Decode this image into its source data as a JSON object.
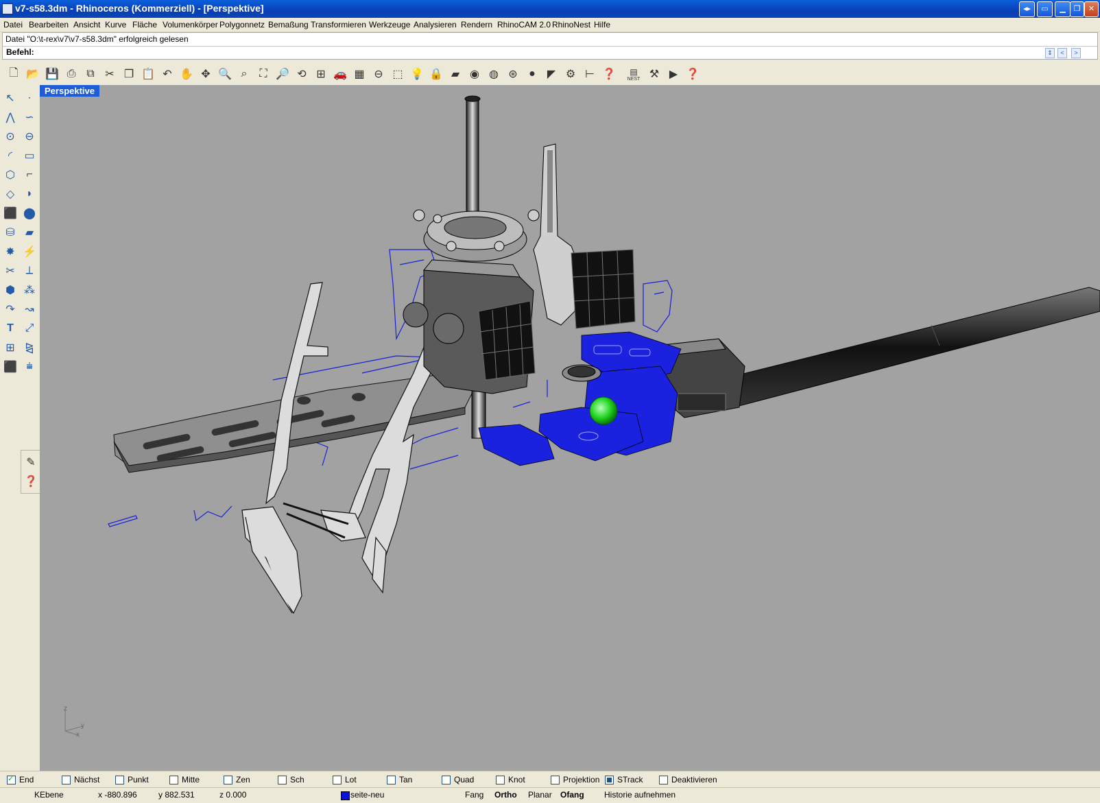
{
  "window": {
    "title": "v7-s58.3dm - Rhinoceros (Kommerziell) - [Perspektive]"
  },
  "menu": [
    "Datei",
    "Bearbeiten",
    "Ansicht",
    "Kurve",
    "Fläche",
    "Volumenkörper",
    "Polygonnetz",
    "Bemaßung",
    "Transformieren",
    "Werkzeuge",
    "Analysieren",
    "Rendern",
    "RhinoCAM 2.0",
    "RhinoNest",
    "Hilfe"
  ],
  "command": {
    "history": "Datei \"O:\\t-rex\\v7\\v7-s58.3dm\" erfolgreich gelesen",
    "label": "Befehl:"
  },
  "toolbar": {
    "nest_label": "NEST"
  },
  "viewport": {
    "title": "Perspektive",
    "axis_z": "z",
    "axis_y": "y",
    "axis_x": "x"
  },
  "osnaps": [
    {
      "label": "End",
      "checked": true
    },
    {
      "label": "Nächst",
      "checked": false
    },
    {
      "label": "Punkt",
      "checked": false
    },
    {
      "label": "Mitte",
      "checked": false
    },
    {
      "label": "Zen",
      "checked": false
    },
    {
      "label": "Sch",
      "checked": false
    },
    {
      "label": "Lot",
      "checked": false
    },
    {
      "label": "Tan",
      "checked": false
    },
    {
      "label": "Quad",
      "checked": false
    },
    {
      "label": "Knot",
      "checked": false
    },
    {
      "label": "Projektion",
      "checked": false
    },
    {
      "label": "STrack",
      "checked": true
    },
    {
      "label": "Deaktivieren",
      "checked": false
    }
  ],
  "status": {
    "cplane": "KEbene",
    "x": "x -880.896",
    "y": "y 882.531",
    "z": "z 0.000",
    "layer": "seite-neu",
    "layer_color": "#0a10d8",
    "fang": "Fang",
    "ortho": "Ortho",
    "planar": "Planar",
    "ofang": "Ofang",
    "history": "Historie aufnehmen"
  },
  "colors": {
    "selection": "#0a10d8",
    "highlight": "#22d422",
    "viewport_bg": "#a2a2a2"
  }
}
